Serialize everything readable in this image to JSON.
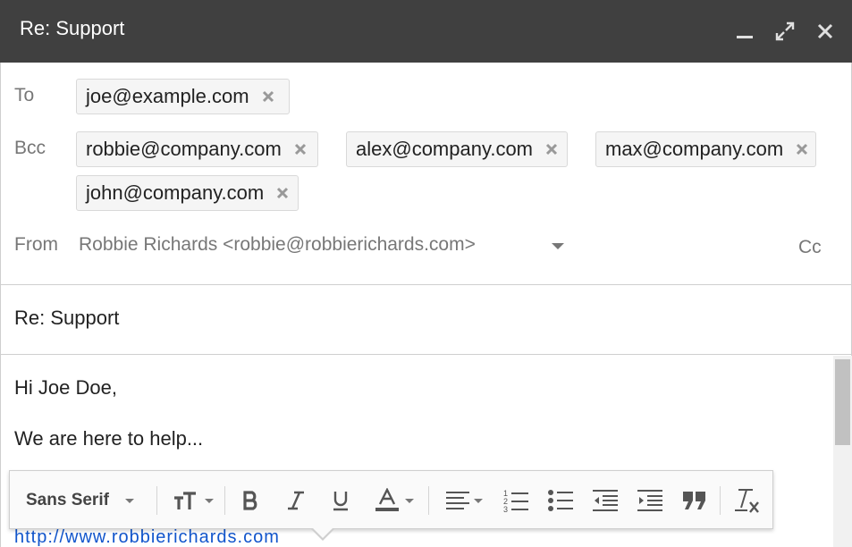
{
  "window": {
    "title": "Re: Support",
    "controls": [
      "minimize-icon",
      "popout-icon",
      "close-icon"
    ]
  },
  "recipients": {
    "to_label": "To",
    "to": [
      "joe@example.com"
    ],
    "bcc_label": "Bcc",
    "bcc": [
      "robbie@company.com",
      "alex@company.com",
      "max@company.com",
      "john@company.com"
    ],
    "from_label": "From",
    "from_value": "Robbie Richards <robbie@robbierichards.com>",
    "cc_link": "Cc"
  },
  "subject": "Re: Support",
  "body": {
    "lines": [
      "Hi Joe Doe,",
      "We are here to help..."
    ],
    "partial_link": "http://www.robbierichards.com"
  },
  "toolbar": {
    "font_family": "Sans Serif",
    "tools": [
      "font-size-icon",
      "bold-icon",
      "italic-icon",
      "underline-icon",
      "text-color-icon",
      "align-icon",
      "numbered-list-icon",
      "bulleted-list-icon",
      "indent-less-icon",
      "indent-more-icon",
      "quote-icon",
      "remove-formatting-icon"
    ]
  },
  "colors": {
    "titlebar": "#404040",
    "link": "#1155cc",
    "muted_text": "#777777"
  }
}
